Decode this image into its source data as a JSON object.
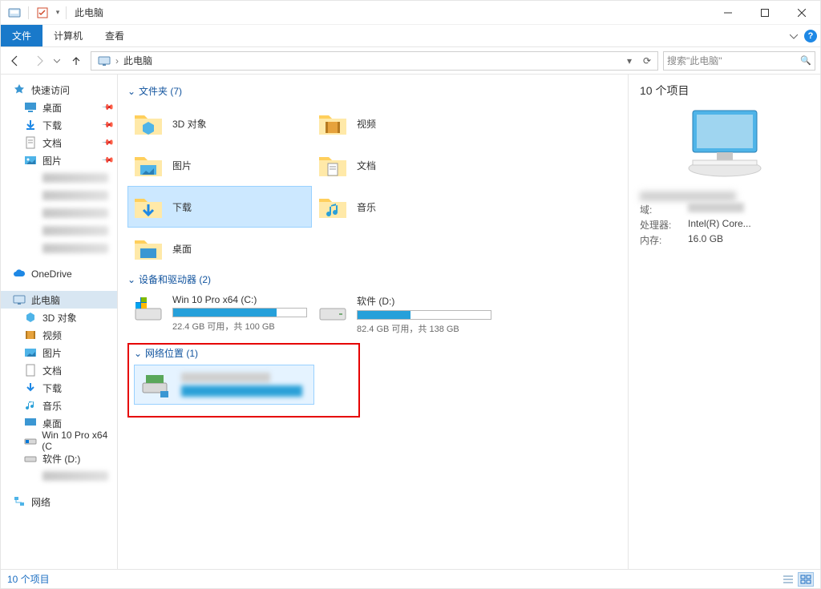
{
  "titlebar": {
    "app_title": "此电脑",
    "qat": {
      "dropdown": "▾"
    }
  },
  "ribbon": {
    "file": "文件",
    "computer": "计算机",
    "view": "查看"
  },
  "address": {
    "crumb1": "此电脑",
    "dropdown_glyph": "▾",
    "refresh_glyph": "⟳"
  },
  "search": {
    "placeholder": "搜索\"此电脑\"",
    "icon_glyph": "🔍"
  },
  "nav": {
    "quick_access": "快速访问",
    "desktop": "桌面",
    "downloads": "下载",
    "documents": "文档",
    "pictures": "图片",
    "onedrive": "OneDrive",
    "this_pc": "此电脑",
    "3d_objects": "3D 对象",
    "videos": "视频",
    "music": "音乐",
    "drive_c": "Win 10 Pro x64 (C",
    "drive_d": "软件 (D:)",
    "network": "网络"
  },
  "content": {
    "group_folders": "文件夹 (7)",
    "group_drives": "设备和驱动器 (2)",
    "group_network": "网络位置 (1)",
    "tiles": {
      "3d_objects": "3D 对象",
      "videos": "视频",
      "pictures": "图片",
      "documents": "文档",
      "downloads": "下载",
      "music": "音乐",
      "desktop": "桌面"
    },
    "drive_c": {
      "name": "Win 10 Pro x64 (C:)",
      "sub": "22.4 GB 可用，共 100 GB",
      "fill_pct": 78
    },
    "drive_d": {
      "name": "软件 (D:)",
      "sub": "82.4 GB 可用，共 138 GB",
      "fill_pct": 40
    }
  },
  "details": {
    "count": "10 个项目",
    "labels": {
      "domain": "域:",
      "cpu": "处理器:",
      "mem": "内存:"
    },
    "values": {
      "cpu": "Intel(R) Core...",
      "mem": "16.0 GB"
    }
  },
  "status": {
    "text": "10 个项目"
  }
}
